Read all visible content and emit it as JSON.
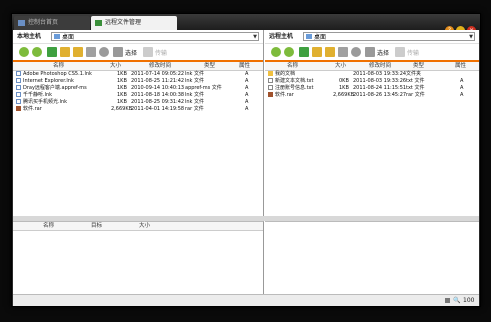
{
  "tabs": [
    {
      "label": "控制台首页"
    },
    {
      "label": "远程文件管理"
    }
  ],
  "colors": {
    "accent": "#f07000",
    "link_icon": "#6a8fc4",
    "folder": "#f0c040",
    "rar": "#a0522d"
  },
  "local": {
    "host_label": "本地主机",
    "location": "桌面",
    "toolbar": {
      "select_label": "选择",
      "transfer_label": "传输"
    },
    "columns": [
      "名称",
      "大小",
      "修改时间",
      "类型",
      "属性"
    ],
    "files": [
      {
        "name": "Adobe Photoshop CS5.1.lnk",
        "size": "1KB",
        "mtime": "2011-07-14 09:05:22",
        "type": "lnk 文件",
        "attr": "A",
        "icon": "link-file-icon"
      },
      {
        "name": "Internet Explorer.lnk",
        "size": "1KB",
        "mtime": "2011-08-25 11:21:42",
        "type": "lnk 文件",
        "attr": "A",
        "icon": "link-file-icon"
      },
      {
        "name": "Dray远程客户端.appref-ms",
        "size": "1KB",
        "mtime": "2010-09-14 10:40:13",
        "type": "appref-ms 文件",
        "attr": "A",
        "icon": "link-file-icon"
      },
      {
        "name": "千千静听.lnk",
        "size": "1KB",
        "mtime": "2011-08-18 14:00:38",
        "type": "lnk 文件",
        "attr": "A",
        "icon": "link-file-icon"
      },
      {
        "name": "腾讯买手机频光.lnk",
        "size": "1KB",
        "mtime": "2011-08-25 09:31:42",
        "type": "lnk 文件",
        "attr": "A",
        "icon": "link-file-icon"
      },
      {
        "name": "软件.rar",
        "size": "2,669KB",
        "mtime": "2011-04-01 14:19:58",
        "type": "rar 文件",
        "attr": "A",
        "icon": "rar-file-icon"
      }
    ]
  },
  "remote": {
    "host_label": "远程主机",
    "location": "桌面",
    "toolbar": {
      "select_label": "选择",
      "transfer_label": "传输"
    },
    "columns": [
      "名称",
      "大小",
      "修改时间",
      "类型",
      "属性"
    ],
    "files": [
      {
        "name": "我的文档",
        "size": "",
        "mtime": "2011-08-03 19:33:24",
        "type": "文件夹",
        "attr": "",
        "icon": "folder-icon"
      },
      {
        "name": "新建文本文档.txt",
        "size": "0KB",
        "mtime": "2011-08-03 19:33:26",
        "type": "txt 文件",
        "attr": "A",
        "icon": "text-file-icon"
      },
      {
        "name": "注册账号信息.txt",
        "size": "1KB",
        "mtime": "2011-08-24 11:15:51",
        "type": "txt 文件",
        "attr": "A",
        "icon": "text-file-icon"
      },
      {
        "name": "软件.rar",
        "size": "2,669KB",
        "mtime": "2011-08-26 13:45:27",
        "type": "rar 文件",
        "attr": "A",
        "icon": "rar-file-icon"
      }
    ]
  },
  "transfer_queue": {
    "columns": [
      "名称",
      "目标",
      "大小"
    ]
  },
  "status": {
    "zoom": "100"
  }
}
